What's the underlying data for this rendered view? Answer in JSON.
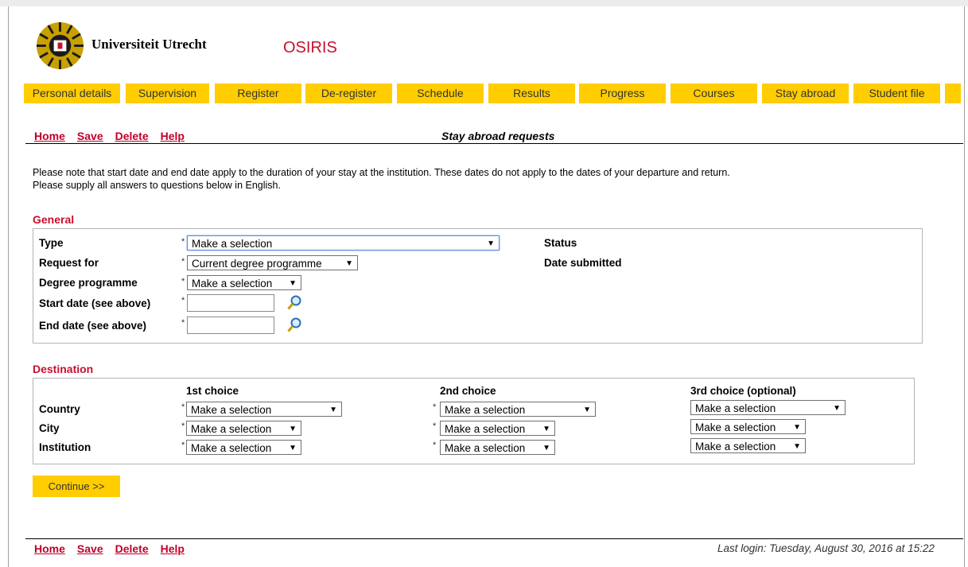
{
  "header": {
    "university_name": "Universiteit Utrecht",
    "app_name": "OSIRIS"
  },
  "nav": {
    "items": [
      {
        "label": "Personal details"
      },
      {
        "label": "Supervision"
      },
      {
        "label": "Register"
      },
      {
        "label": "De-register"
      },
      {
        "label": "Schedule"
      },
      {
        "label": "Results"
      },
      {
        "label": "Progress"
      },
      {
        "label": "Courses"
      },
      {
        "label": "Stay abroad"
      },
      {
        "label": "Student file"
      }
    ]
  },
  "toolbar": {
    "home": "Home",
    "save": "Save",
    "delete": "Delete",
    "help": "Help",
    "page_title": "Stay abroad requests"
  },
  "notes": {
    "line1": "Please note that start date and end date apply to the duration of your stay at the institution. These dates do not apply to the dates of your departure and return.",
    "line2": "Please supply all answers to questions below in English."
  },
  "general": {
    "heading": "General",
    "required_mark": "*",
    "type_label": "Type",
    "type_value": "Make a selection",
    "request_for_label": "Request for",
    "request_for_value": "Current degree programme",
    "degree_programme_label": "Degree programme",
    "degree_programme_value": "Make a selection",
    "start_date_label": "Start date (see above)",
    "start_date_value": "",
    "end_date_label": "End date (see above)",
    "end_date_value": "",
    "status_label": "Status",
    "date_submitted_label": "Date submitted"
  },
  "destination": {
    "heading": "Destination",
    "country_label": "Country",
    "city_label": "City",
    "institution_label": "Institution",
    "choice1": {
      "heading": "1st choice",
      "country": "Make a selection",
      "city": "Make a selection",
      "institution": "Make a selection"
    },
    "choice2": {
      "heading": "2nd choice",
      "country": "Make a selection",
      "city": "Make a selection",
      "institution": "Make a selection"
    },
    "choice3": {
      "heading": "3rd choice (optional)",
      "country": "Make a selection",
      "city": "Make a selection",
      "institution": "Make a selection"
    }
  },
  "continue_button": "Continue >>",
  "footer": {
    "home": "Home",
    "save": "Save",
    "delete": "Delete",
    "help": "Help",
    "last_login": "Last login: Tuesday, August 30, 2016 at 15:22"
  },
  "colors": {
    "accent": "#ffcd00",
    "link": "#c00028",
    "heading": "#c8102e"
  }
}
